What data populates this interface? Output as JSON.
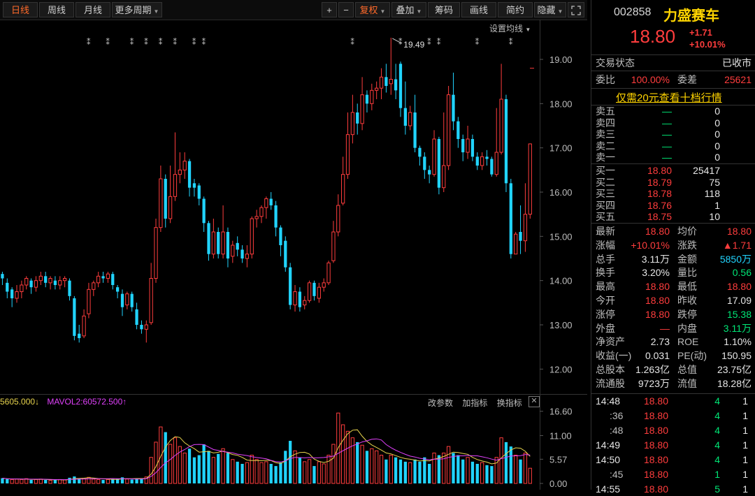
{
  "toolbar": {
    "periods": [
      "日线",
      "周线",
      "月线"
    ],
    "more_periods": "更多周期",
    "plus": "+",
    "minus": "−",
    "fuquan": "复权",
    "overlay": "叠加",
    "chips": "筹码",
    "drawing": "画线",
    "simple": "简约",
    "hide": "隐藏",
    "fullscreen_icon": "fullscreen-icon"
  },
  "chart": {
    "setup_ma": "设置均线",
    "price_ticks": [
      "19.00",
      "18.00",
      "17.00",
      "16.00",
      "15.00",
      "14.00",
      "13.00",
      "12.00"
    ],
    "high_label": "19.49",
    "vol_ticks": [
      "16.60",
      "11.00",
      "5.57",
      "0.00"
    ],
    "vol_legend_1": "5605.000",
    "vol_legend_2": "MAVOL2:60572.500",
    "vol_tools": [
      "改参数",
      "加指标",
      "换指标"
    ],
    "close_icon": "close-icon",
    "colors": {
      "up": "#ff3d3d",
      "down": "#21d4ff",
      "ma1": "#e8d44d",
      "ma2": "#e040fb"
    }
  },
  "chart_data": {
    "type": "candlestick",
    "y_range": [
      11.5,
      19.9
    ],
    "vol_range": [
      0,
      18
    ],
    "candles": [
      [
        14.05,
        14.15,
        13.9,
        14.2,
        "d"
      ],
      [
        13.95,
        13.75,
        13.6,
        14.05,
        "d"
      ],
      [
        13.8,
        13.6,
        13.4,
        13.85,
        "d"
      ],
      [
        13.6,
        13.75,
        13.5,
        13.9,
        "u"
      ],
      [
        13.75,
        13.9,
        13.6,
        14.0,
        "u"
      ],
      [
        13.9,
        14.05,
        13.8,
        14.1,
        "u"
      ],
      [
        14.0,
        13.85,
        13.7,
        14.05,
        "d"
      ],
      [
        13.85,
        14.0,
        13.75,
        14.1,
        "u"
      ],
      [
        14.0,
        14.1,
        13.9,
        14.2,
        "u"
      ],
      [
        14.1,
        13.95,
        13.85,
        14.2,
        "d"
      ],
      [
        13.95,
        14.05,
        13.8,
        14.1,
        "u"
      ],
      [
        14.0,
        13.9,
        13.8,
        14.1,
        "d"
      ],
      [
        13.9,
        14.0,
        13.8,
        14.1,
        "u"
      ],
      [
        14.0,
        14.05,
        13.85,
        14.1,
        "u"
      ],
      [
        14.0,
        13.65,
        13.55,
        14.05,
        "d"
      ],
      [
        13.6,
        12.75,
        12.65,
        13.65,
        "d"
      ],
      [
        12.8,
        12.7,
        12.6,
        13.0,
        "d"
      ],
      [
        12.75,
        13.2,
        12.7,
        13.35,
        "u"
      ],
      [
        13.25,
        13.8,
        13.15,
        13.95,
        "u"
      ],
      [
        13.8,
        13.95,
        13.65,
        14.0,
        "u"
      ],
      [
        13.95,
        14.1,
        13.85,
        14.2,
        "u"
      ],
      [
        14.1,
        14.05,
        13.95,
        14.2,
        "d"
      ],
      [
        14.05,
        14.15,
        13.95,
        14.2,
        "u"
      ],
      [
        14.15,
        13.9,
        13.8,
        14.2,
        "d"
      ],
      [
        13.85,
        13.75,
        13.6,
        13.9,
        "d"
      ],
      [
        13.7,
        13.4,
        13.2,
        13.8,
        "d"
      ],
      [
        13.45,
        13.7,
        13.35,
        13.75,
        "u"
      ],
      [
        13.7,
        13.4,
        13.3,
        13.75,
        "d"
      ],
      [
        13.35,
        13.0,
        12.9,
        13.5,
        "d"
      ],
      [
        13.0,
        12.9,
        12.8,
        13.1,
        "d"
      ],
      [
        12.9,
        13.0,
        12.6,
        13.1,
        "u"
      ],
      [
        13.05,
        14.05,
        13.0,
        14.4,
        "u"
      ],
      [
        14.05,
        15.2,
        13.95,
        15.4,
        "u"
      ],
      [
        15.2,
        16.3,
        15.1,
        16.6,
        "u"
      ],
      [
        16.3,
        15.4,
        15.2,
        16.4,
        "d"
      ],
      [
        15.4,
        15.9,
        15.3,
        16.6,
        "u"
      ],
      [
        15.9,
        16.4,
        15.8,
        17.35,
        "u"
      ],
      [
        16.4,
        16.5,
        16.2,
        16.9,
        "u"
      ],
      [
        16.5,
        16.7,
        16.3,
        16.9,
        "u"
      ],
      [
        16.7,
        16.1,
        15.9,
        16.75,
        "d"
      ],
      [
        16.1,
        16.2,
        15.9,
        16.3,
        "d"
      ],
      [
        16.15,
        15.85,
        15.7,
        16.2,
        "d"
      ],
      [
        15.85,
        15.3,
        15.1,
        15.9,
        "d"
      ],
      [
        15.3,
        14.6,
        14.45,
        15.35,
        "d"
      ],
      [
        14.6,
        15.1,
        14.5,
        15.4,
        "u"
      ],
      [
        15.1,
        14.6,
        14.5,
        15.2,
        "d"
      ],
      [
        14.6,
        15.1,
        14.5,
        15.7,
        "u"
      ],
      [
        15.1,
        14.5,
        14.3,
        15.2,
        "d"
      ],
      [
        14.55,
        14.8,
        14.4,
        14.9,
        "u"
      ],
      [
        14.85,
        14.7,
        14.55,
        15.0,
        "d"
      ],
      [
        14.7,
        14.5,
        14.4,
        14.8,
        "d"
      ],
      [
        14.5,
        14.6,
        14.3,
        14.8,
        "u"
      ],
      [
        14.6,
        15.4,
        14.5,
        15.45,
        "u"
      ],
      [
        15.4,
        15.45,
        15.2,
        15.6,
        "u"
      ],
      [
        15.45,
        15.65,
        15.3,
        15.7,
        "u"
      ],
      [
        15.65,
        15.85,
        15.4,
        15.9,
        "u"
      ],
      [
        15.85,
        15.7,
        15.6,
        16.0,
        "d"
      ],
      [
        15.7,
        15.2,
        15.0,
        15.8,
        "d"
      ],
      [
        15.2,
        14.8,
        14.55,
        15.25,
        "d"
      ],
      [
        14.9,
        14.3,
        14.2,
        15.0,
        "d"
      ],
      [
        14.3,
        13.45,
        13.35,
        14.4,
        "d"
      ],
      [
        13.45,
        13.75,
        13.3,
        13.9,
        "u"
      ],
      [
        13.75,
        13.4,
        13.3,
        13.85,
        "d"
      ],
      [
        13.45,
        13.55,
        13.35,
        13.65,
        "u"
      ],
      [
        13.55,
        13.95,
        13.5,
        14.0,
        "u"
      ],
      [
        13.95,
        13.65,
        13.55,
        14.0,
        "d"
      ],
      [
        13.6,
        13.85,
        13.5,
        13.95,
        "u"
      ],
      [
        13.85,
        13.95,
        13.75,
        14.05,
        "u"
      ],
      [
        13.95,
        14.4,
        13.9,
        14.45,
        "u"
      ],
      [
        14.45,
        15.1,
        14.4,
        15.35,
        "u"
      ],
      [
        15.1,
        15.7,
        15.0,
        15.95,
        "u"
      ],
      [
        15.75,
        16.4,
        15.7,
        16.8,
        "u"
      ],
      [
        16.4,
        17.3,
        16.3,
        17.8,
        "u"
      ],
      [
        17.3,
        17.8,
        17.1,
        18.2,
        "u"
      ],
      [
        17.8,
        17.55,
        17.3,
        18.0,
        "d"
      ],
      [
        17.55,
        18.2,
        17.4,
        18.6,
        "u"
      ],
      [
        18.2,
        18.0,
        17.8,
        18.3,
        "d"
      ],
      [
        18.0,
        18.3,
        17.85,
        18.45,
        "u"
      ],
      [
        18.3,
        18.35,
        18.1,
        18.5,
        "u"
      ],
      [
        18.35,
        18.6,
        18.1,
        18.8,
        "u"
      ],
      [
        18.6,
        18.4,
        18.25,
        18.9,
        "d"
      ],
      [
        18.45,
        18.55,
        18.2,
        19.49,
        "u"
      ],
      [
        18.55,
        18.3,
        18.1,
        18.9,
        "d"
      ],
      [
        18.9,
        17.9,
        17.7,
        18.95,
        "d"
      ],
      [
        17.9,
        17.5,
        17.3,
        18.5,
        "d"
      ],
      [
        17.5,
        17.8,
        17.4,
        17.95,
        "u"
      ],
      [
        17.8,
        17.0,
        16.9,
        18.2,
        "d"
      ],
      [
        17.0,
        16.8,
        16.6,
        17.05,
        "d"
      ],
      [
        16.8,
        16.5,
        16.3,
        16.9,
        "d"
      ],
      [
        16.5,
        16.4,
        16.2,
        16.6,
        "d"
      ],
      [
        16.4,
        17.2,
        16.35,
        17.4,
        "u"
      ],
      [
        17.2,
        16.1,
        15.95,
        17.25,
        "d"
      ],
      [
        16.1,
        16.6,
        16.0,
        17.8,
        "u"
      ],
      [
        16.6,
        18.2,
        16.5,
        18.4,
        "u"
      ],
      [
        18.2,
        17.6,
        17.4,
        18.7,
        "d"
      ],
      [
        17.6,
        17.2,
        17.0,
        17.7,
        "d"
      ],
      [
        17.2,
        16.9,
        16.7,
        17.3,
        "d"
      ],
      [
        16.9,
        17.2,
        16.75,
        17.5,
        "u"
      ],
      [
        17.2,
        16.8,
        16.7,
        17.3,
        "d"
      ],
      [
        16.8,
        16.6,
        16.5,
        16.9,
        "d"
      ],
      [
        16.6,
        16.8,
        16.5,
        16.9,
        "u"
      ],
      [
        16.8,
        16.75,
        16.6,
        16.95,
        "d"
      ],
      [
        16.75,
        16.4,
        16.35,
        16.8,
        "d"
      ],
      [
        16.4,
        16.9,
        16.35,
        17.9,
        "u"
      ],
      [
        16.9,
        18.1,
        16.85,
        18.9,
        "u"
      ],
      [
        18.1,
        16.2,
        16.0,
        18.2,
        "d"
      ],
      [
        16.2,
        14.6,
        14.5,
        16.3,
        "d"
      ],
      [
        14.6,
        15.05,
        14.6,
        15.1,
        "u"
      ],
      [
        15.1,
        14.9,
        14.6,
        15.7,
        "d"
      ],
      [
        14.9,
        15.5,
        14.65,
        16.2,
        "u"
      ],
      [
        15.5,
        17.09,
        15.4,
        17.1,
        "u"
      ]
    ],
    "volumes": [
      [
        1.2,
        "d"
      ],
      [
        1.0,
        "d"
      ],
      [
        0.9,
        "u"
      ],
      [
        1.0,
        "u"
      ],
      [
        0.9,
        "u"
      ],
      [
        1.1,
        "u"
      ],
      [
        0.8,
        "d"
      ],
      [
        0.9,
        "u"
      ],
      [
        1.0,
        "u"
      ],
      [
        0.8,
        "d"
      ],
      [
        0.7,
        "u"
      ],
      [
        0.8,
        "d"
      ],
      [
        0.9,
        "u"
      ],
      [
        0.8,
        "u"
      ],
      [
        1.3,
        "d"
      ],
      [
        1.6,
        "d"
      ],
      [
        1.1,
        "d"
      ],
      [
        1.2,
        "u"
      ],
      [
        1.4,
        "u"
      ],
      [
        1.0,
        "u"
      ],
      [
        0.9,
        "u"
      ],
      [
        0.8,
        "d"
      ],
      [
        0.9,
        "u"
      ],
      [
        1.0,
        "d"
      ],
      [
        1.1,
        "d"
      ],
      [
        1.4,
        "d"
      ],
      [
        1.0,
        "u"
      ],
      [
        0.9,
        "d"
      ],
      [
        1.2,
        "d"
      ],
      [
        1.1,
        "d"
      ],
      [
        1.5,
        "u"
      ],
      [
        6.0,
        "u"
      ],
      [
        9.5,
        "u"
      ],
      [
        13.0,
        "u"
      ],
      [
        11.8,
        "d"
      ],
      [
        9.0,
        "u"
      ],
      [
        10.5,
        "u"
      ],
      [
        8.5,
        "u"
      ],
      [
        7.0,
        "u"
      ],
      [
        8.0,
        "d"
      ],
      [
        6.0,
        "d"
      ],
      [
        6.5,
        "d"
      ],
      [
        9.0,
        "d"
      ],
      [
        7.5,
        "d"
      ],
      [
        6.0,
        "u"
      ],
      [
        6.8,
        "d"
      ],
      [
        8.0,
        "u"
      ],
      [
        7.0,
        "d"
      ],
      [
        5.5,
        "u"
      ],
      [
        5.0,
        "d"
      ],
      [
        4.5,
        "d"
      ],
      [
        4.8,
        "u"
      ],
      [
        6.5,
        "u"
      ],
      [
        5.5,
        "u"
      ],
      [
        4.8,
        "u"
      ],
      [
        5.0,
        "u"
      ],
      [
        4.5,
        "d"
      ],
      [
        4.0,
        "d"
      ],
      [
        4.8,
        "d"
      ],
      [
        7.5,
        "d"
      ],
      [
        9.8,
        "d"
      ],
      [
        7.5,
        "u"
      ],
      [
        6.0,
        "d"
      ],
      [
        5.0,
        "u"
      ],
      [
        5.5,
        "u"
      ],
      [
        4.0,
        "d"
      ],
      [
        5.0,
        "u"
      ],
      [
        4.5,
        "u"
      ],
      [
        6.5,
        "u"
      ],
      [
        9.0,
        "u"
      ],
      [
        16.2,
        "u"
      ],
      [
        13.5,
        "u"
      ],
      [
        12.0,
        "u"
      ],
      [
        10.5,
        "u"
      ],
      [
        9.5,
        "d"
      ],
      [
        8.8,
        "u"
      ],
      [
        7.5,
        "d"
      ],
      [
        8.0,
        "u"
      ],
      [
        7.5,
        "u"
      ],
      [
        6.5,
        "u"
      ],
      [
        5.5,
        "d"
      ],
      [
        6.5,
        "u"
      ],
      [
        6.0,
        "d"
      ],
      [
        5.5,
        "d"
      ],
      [
        5.0,
        "d"
      ],
      [
        4.8,
        "u"
      ],
      [
        5.5,
        "d"
      ],
      [
        5.0,
        "d"
      ],
      [
        6.0,
        "d"
      ],
      [
        4.5,
        "d"
      ],
      [
        7.0,
        "u"
      ],
      [
        6.5,
        "d"
      ],
      [
        7.0,
        "u"
      ],
      [
        8.5,
        "u"
      ],
      [
        7.0,
        "d"
      ],
      [
        6.5,
        "d"
      ],
      [
        5.5,
        "d"
      ],
      [
        6.0,
        "u"
      ],
      [
        5.0,
        "d"
      ],
      [
        4.5,
        "d"
      ],
      [
        4.8,
        "u"
      ],
      [
        4.2,
        "d"
      ],
      [
        4.0,
        "d"
      ],
      [
        6.0,
        "u"
      ],
      [
        10.5,
        "u"
      ],
      [
        9.5,
        "d"
      ],
      [
        8.5,
        "d"
      ],
      [
        6.5,
        "u"
      ],
      [
        5.5,
        "d"
      ],
      [
        7.0,
        "u"
      ],
      [
        3.5,
        "u"
      ]
    ]
  },
  "panel": {
    "code": "002858",
    "name": "力盛赛车",
    "price": "18.80",
    "change": "+1.71",
    "change_pct": "+10.01%",
    "status_label": "交易状态",
    "status_value": "已收市",
    "weibi_label": "委比",
    "weibi_value": "100.00%",
    "weicha_label": "委差",
    "weicha_value": "25621",
    "banner": "仅需20元查看十档行情",
    "asks": [
      {
        "label": "卖五",
        "price": "—",
        "vol": "0"
      },
      {
        "label": "卖四",
        "price": "—",
        "vol": "0"
      },
      {
        "label": "卖三",
        "price": "—",
        "vol": "0"
      },
      {
        "label": "卖二",
        "price": "—",
        "vol": "0"
      },
      {
        "label": "卖一",
        "price": "—",
        "vol": "0"
      }
    ],
    "bids": [
      {
        "label": "买一",
        "price": "18.80",
        "vol": "25417"
      },
      {
        "label": "买二",
        "price": "18.79",
        "vol": "75"
      },
      {
        "label": "买三",
        "price": "18.78",
        "vol": "118"
      },
      {
        "label": "买四",
        "price": "18.76",
        "vol": "1"
      },
      {
        "label": "买五",
        "price": "18.75",
        "vol": "10"
      }
    ],
    "fields": [
      {
        "l1": "最新",
        "v1": "18.80",
        "c1": "red",
        "l2": "均价",
        "v2": "18.80",
        "c2": "red"
      },
      {
        "l1": "涨幅",
        "v1": "+10.01%",
        "c1": "red",
        "l2": "涨跌",
        "v2": "▲1.71",
        "c2": "red"
      },
      {
        "l1": "总手",
        "v1": "3.11万",
        "c1": "white",
        "l2": "金额",
        "v2": "5850万",
        "c2": "cyan"
      },
      {
        "l1": "换手",
        "v1": "3.20%",
        "c1": "white",
        "l2": "量比",
        "v2": "0.56",
        "c2": "green"
      },
      {
        "l1": "最高",
        "v1": "18.80",
        "c1": "red",
        "l2": "最低",
        "v2": "18.80",
        "c2": "red"
      },
      {
        "l1": "今开",
        "v1": "18.80",
        "c1": "red",
        "l2": "昨收",
        "v2": "17.09",
        "c2": "white"
      },
      {
        "l1": "涨停",
        "v1": "18.80",
        "c1": "red",
        "l2": "跌停",
        "v2": "15.38",
        "c2": "green"
      },
      {
        "l1": "外盘",
        "v1": "—",
        "c1": "red",
        "l2": "内盘",
        "v2": "3.11万",
        "c2": "green"
      },
      {
        "l1": "净资产",
        "v1": "2.73",
        "c1": "white",
        "l2": "ROE",
        "v2": "1.10%",
        "c2": "white"
      },
      {
        "l1": "收益(一)",
        "v1": "0.031",
        "c1": "white",
        "l2": "PE(动)",
        "v2": "150.95",
        "c2": "white"
      },
      {
        "l1": "总股本",
        "v1": "1.263亿",
        "c1": "white",
        "l2": "总值",
        "v2": "23.75亿",
        "c2": "white"
      },
      {
        "l1": "流通股",
        "v1": "9723万",
        "c1": "white",
        "l2": "流值",
        "v2": "18.28亿",
        "c2": "white"
      }
    ],
    "ticks": [
      {
        "time": "14:48",
        "price": "18.80",
        "vol": "4",
        "n": "1",
        "tc": "white"
      },
      {
        "time": ":36",
        "price": "18.80",
        "vol": "4",
        "n": "1",
        "tc": "gray"
      },
      {
        "time": ":48",
        "price": "18.80",
        "vol": "4",
        "n": "1",
        "tc": "gray"
      },
      {
        "time": "14:49",
        "price": "18.80",
        "vol": "4",
        "n": "1",
        "tc": "white"
      },
      {
        "time": "14:50",
        "price": "18.80",
        "vol": "4",
        "n": "1",
        "tc": "white"
      },
      {
        "time": ":45",
        "price": "18.80",
        "vol": "1",
        "n": "1",
        "tc": "gray"
      },
      {
        "time": "14:55",
        "price": "18.80",
        "vol": "5",
        "n": "1",
        "tc": "white"
      }
    ]
  }
}
